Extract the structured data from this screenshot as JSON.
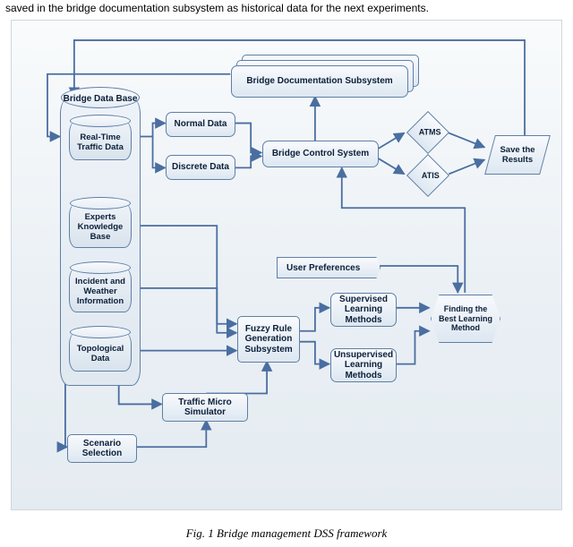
{
  "top_fragment": "saved in the bridge documentation subsystem as historical data for the next experiments.",
  "caption": "Fig. 1      Bridge management DSS framework",
  "db": {
    "title": "Bridge Data Base",
    "items": [
      "Real-Time Traffic Data",
      "Experts Knowledge Base",
      "Incident and Weather Information",
      "Topological Data"
    ]
  },
  "nodes": {
    "normal": "Normal Data",
    "discrete": "Discrete Data",
    "doc": "Bridge Documentation Subsystem",
    "control": "Bridge Control System",
    "atms": "ATMS",
    "atis": "ATIS",
    "save": "Save the Results",
    "userpref": "User Preferences",
    "fuzzy": "Fuzzy Rule Generation Subsystem",
    "sup": "Supervised Learning Methods",
    "unsup": "Unsupervised Learning Methods",
    "find": "Finding the Best Learning Method",
    "traffic": "Traffic Micro Simulator",
    "scenario": "Scenario Selection"
  }
}
